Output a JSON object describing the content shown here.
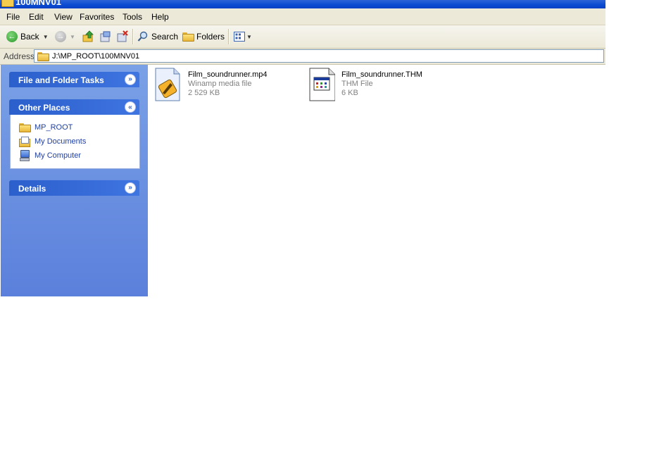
{
  "window": {
    "title": "100MNV01"
  },
  "menu": {
    "file": "File",
    "edit": "Edit",
    "view": "View",
    "favorites": "Favorites",
    "tools": "Tools",
    "help": "Help"
  },
  "toolbar": {
    "back_label": "Back",
    "search_label": "Search",
    "folders_label": "Folders"
  },
  "address": {
    "label": "Address",
    "value": "J:\\MP_ROOT\\100MNV01"
  },
  "taskpane": {
    "file_folder_tasks": "File and Folder Tasks",
    "other_places": {
      "title": "Other Places",
      "items": [
        {
          "label": "MP_ROOT",
          "icon": "folder-icon"
        },
        {
          "label": "My Documents",
          "icon": "my-documents-icon"
        },
        {
          "label": "My Computer",
          "icon": "my-computer-icon"
        }
      ]
    },
    "details": "Details"
  },
  "files": [
    {
      "name": "Film_soundrunner.mp4",
      "type": "Winamp media file",
      "size": "2 529 KB",
      "icon": "winamp-media-file-icon"
    },
    {
      "name": "Film_soundrunner.THM",
      "type": "THM File",
      "size": "6 KB",
      "icon": "thm-file-icon"
    }
  ],
  "colors": {
    "titlebar": "#0a4ad1",
    "taskpane": "#6d92e2",
    "menubar": "#ece9d8",
    "link": "#1f3fa0"
  }
}
